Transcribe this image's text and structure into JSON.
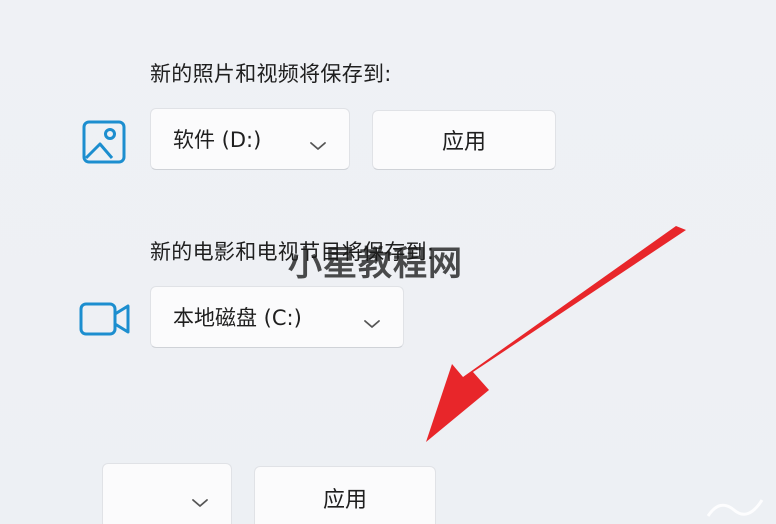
{
  "photos": {
    "label": "新的照片和视频将保存到:",
    "icon": "image-icon",
    "dropdown_value": "软件 (D:)",
    "apply_label": "应用"
  },
  "movies": {
    "label": "新的电影和电视节目将保存到:",
    "icon": "video-camera-icon",
    "dropdown_value": "本地磁盘 (C:)"
  },
  "next_row": {
    "dropdown_value": "",
    "apply_label": "应用"
  },
  "overlay": {
    "watermark": "小星教程网",
    "arrow_color": "#e8262a"
  },
  "colors": {
    "icon_accent": "#0f6cbd",
    "background": "#eef0f4"
  }
}
